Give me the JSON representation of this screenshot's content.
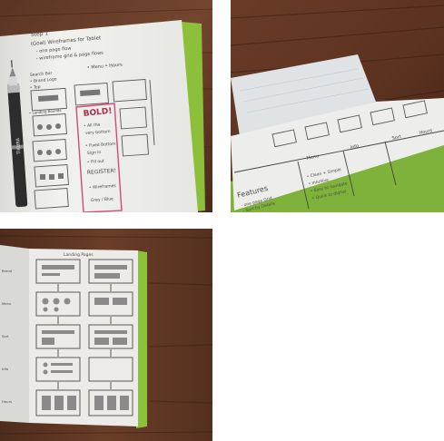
{
  "photos": [
    {
      "notes": {
        "l1": "Step 1",
        "l2": "(Goal) Wireframes for Tablet",
        "l3": "- one page flow",
        "l4": "- wireframe grid & page flows",
        "tabs": "• Menu   • Hours",
        "side1": "Search Bar",
        "side2": "• Brand Logo",
        "side3": "• Top",
        "cap1": "• Landing Bounds",
        "red1": "BOLD!",
        "red2": "• All the",
        "red3": "very bottom",
        "red4": "• Fixed Bottom",
        "red5": "Sign in",
        "red6": "• Fill out",
        "red7": "REGISTER!",
        "red8": "• Wireframes",
        "red9": "Grey / Blue",
        "pen": "TIKURA"
      }
    },
    {
      "notes": {
        "h1": "Features",
        "f1": "- one page Grid",
        "f2": "- Sort by Details",
        "c1": "Menu",
        "c2": "Info",
        "c3": "Sort",
        "c4": "Hours",
        "r1": "• Clean + Simple",
        "r2": "• Intuitive",
        "r3": "• Easy to navigate",
        "r4": "• Quick to digital"
      }
    },
    {
      "notes": {
        "top": "Landing Pages",
        "lab1": "Brand",
        "lab2": "Menu",
        "lab3": "Sort",
        "lab4": "Info",
        "lab5": "Hours"
      }
    }
  ]
}
